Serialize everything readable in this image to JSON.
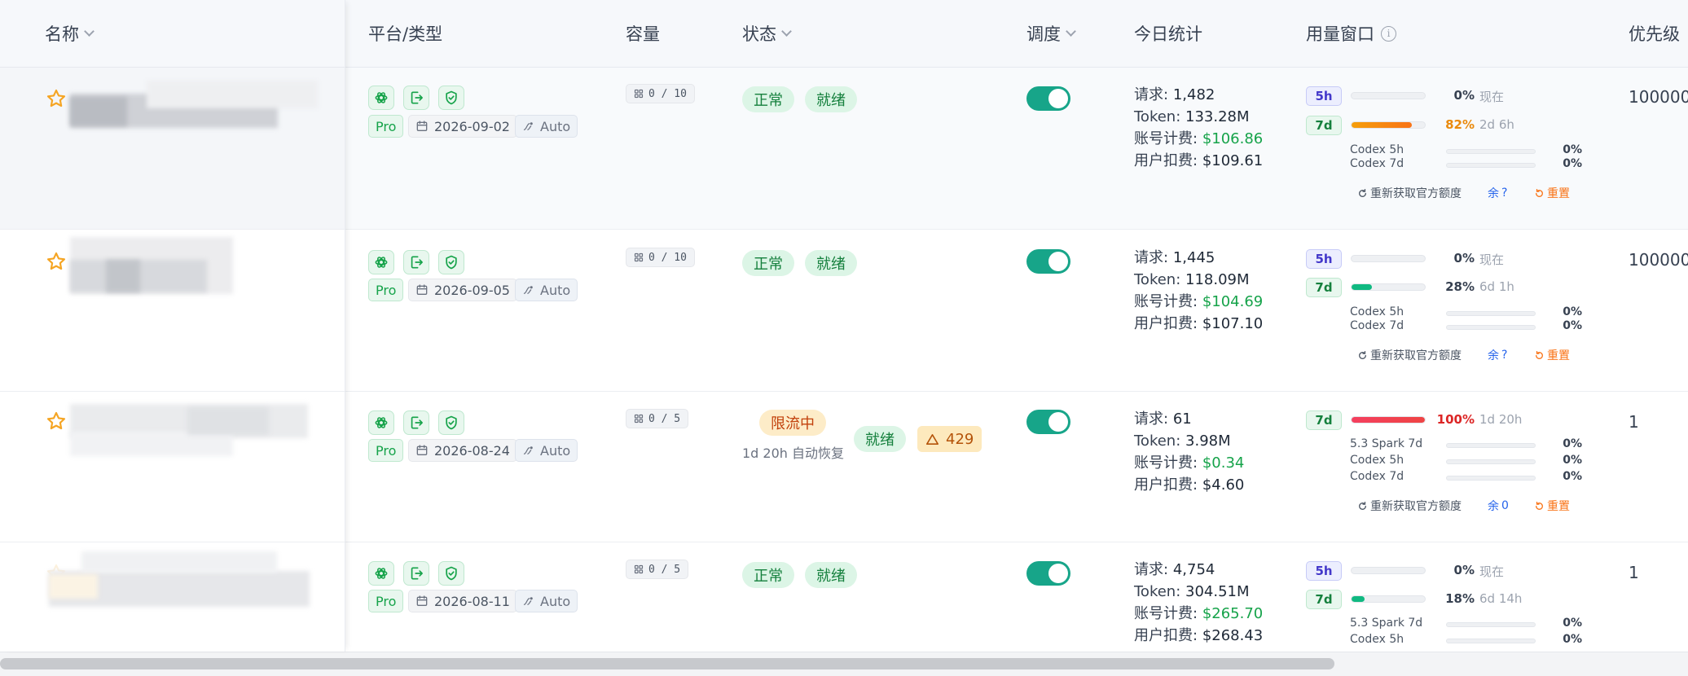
{
  "header": {
    "name": "名称",
    "platform": "平台/类型",
    "capacity": "容量",
    "status": "状态",
    "schedule": "调度",
    "today": "今日统计",
    "usage": "用量窗口",
    "priority": "优先级"
  },
  "labels": {
    "requests": "请求:",
    "token": "Token:",
    "account_fee": "账号计费:",
    "user_fee": "用户扣费:",
    "refresh": "重新获取官方额度",
    "remaining": "余",
    "reset": "重置"
  },
  "colors": {
    "accent": "#17a589",
    "money": "#16a34a",
    "toggle": "#17a589"
  },
  "rows": [
    {
      "date": "2026-09-02",
      "tier": "Pro",
      "mode": "Auto",
      "capacity": "0 / 10",
      "status": "正常",
      "ready": "就绪",
      "requests": "1,482",
      "token": "133.28M",
      "account_fee": "$106.86",
      "user_fee": "$109.61",
      "w1": {
        "label": "5h",
        "value": 0,
        "pct": "0%",
        "reset": "现在"
      },
      "w2": {
        "label": "7d",
        "value": 82,
        "pct": "82%",
        "reset": "2d 6h"
      },
      "subs": [
        {
          "name": "Codex 5h",
          "pct": "0%"
        },
        {
          "name": "Codex 7d",
          "pct": "0%"
        }
      ],
      "remaining_value": "?",
      "priority": "100000"
    },
    {
      "date": "2026-09-05",
      "tier": "Pro",
      "mode": "Auto",
      "capacity": "0 / 10",
      "status": "正常",
      "ready": "就绪",
      "requests": "1,445",
      "token": "118.09M",
      "account_fee": "$104.69",
      "user_fee": "$107.10",
      "w1": {
        "label": "5h",
        "value": 0,
        "pct": "0%",
        "reset": "现在"
      },
      "w2": {
        "label": "7d",
        "value": 28,
        "pct": "28%",
        "reset": "6d 1h"
      },
      "subs": [
        {
          "name": "Codex 5h",
          "pct": "0%"
        },
        {
          "name": "Codex 7d",
          "pct": "0%"
        }
      ],
      "remaining_value": "?",
      "priority": "100000"
    },
    {
      "date": "2026-08-24",
      "tier": "Pro",
      "mode": "Auto",
      "capacity": "0 / 5",
      "status": "限流中",
      "status_sub": "1d 20h 自动恢复",
      "ready": "就绪",
      "warn": "429",
      "requests": "61",
      "token": "3.98M",
      "account_fee": "$0.34",
      "user_fee": "$4.60",
      "w1": {
        "label": "7d",
        "value": 100,
        "pct": "100%",
        "reset": "1d 20h"
      },
      "subs": [
        {
          "name": "5.3 Spark 7d",
          "pct": "0%"
        },
        {
          "name": "Codex 5h",
          "pct": "0%"
        },
        {
          "name": "Codex 7d",
          "pct": "0%"
        }
      ],
      "remaining_value": "0",
      "priority": "1"
    },
    {
      "date": "2026-08-11",
      "tier": "Pro",
      "mode": "Auto",
      "capacity": "0 / 5",
      "status": "正常",
      "ready": "就绪",
      "requests": "4,754",
      "token": "304.51M",
      "account_fee": "$265.70",
      "user_fee": "$268.43",
      "w1": {
        "label": "5h",
        "value": 0,
        "pct": "0%",
        "reset": "现在"
      },
      "w2": {
        "label": "7d",
        "value": 18,
        "pct": "18%",
        "reset": "6d 14h"
      },
      "subs": [
        {
          "name": "5.3 Spark 7d",
          "pct": "0%"
        },
        {
          "name": "Codex 5h",
          "pct": "0%"
        }
      ],
      "priority": "1"
    }
  ]
}
